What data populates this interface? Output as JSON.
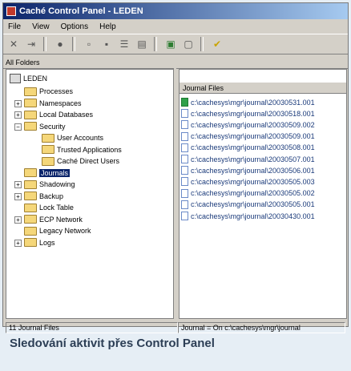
{
  "window": {
    "title": "Caché Control Panel - LEDEN"
  },
  "menu": [
    "File",
    "View",
    "Options",
    "Help"
  ],
  "panels": {
    "left_header": "All Folders",
    "right_header": ""
  },
  "tree": {
    "root": "LEDEN",
    "items": [
      {
        "label": "Processes",
        "expander": ""
      },
      {
        "label": "Namespaces",
        "expander": "+"
      },
      {
        "label": "Local Databases",
        "expander": "+"
      },
      {
        "label": "Security",
        "expander": "−"
      },
      {
        "label": "User Accounts",
        "expander": ""
      },
      {
        "label": "Trusted Applications",
        "expander": ""
      },
      {
        "label": "Caché Direct Users",
        "expander": ""
      },
      {
        "label": "Journals",
        "expander": ""
      },
      {
        "label": "Shadowing",
        "expander": "+"
      },
      {
        "label": "Backup",
        "expander": "+"
      },
      {
        "label": "Lock Table",
        "expander": ""
      },
      {
        "label": "ECP Network",
        "expander": "+"
      },
      {
        "label": "Legacy Network",
        "expander": ""
      },
      {
        "label": "Logs",
        "expander": "+"
      }
    ]
  },
  "list": {
    "column_header": "Journal Files",
    "rows": [
      "c:\\cachesys\\mgr\\journal\\20030531.001",
      "c:\\cachesys\\mgr\\journal\\20030518.001",
      "c:\\cachesys\\mgr\\journal\\20030509.002",
      "c:\\cachesys\\mgr\\journal\\20030509.001",
      "c:\\cachesys\\mgr\\journal\\20030508.001",
      "c:\\cachesys\\mgr\\journal\\20030507.001",
      "c:\\cachesys\\mgr\\journal\\20030506.001",
      "c:\\cachesys\\mgr\\journal\\20030505.003",
      "c:\\cachesys\\mgr\\journal\\20030505.002",
      "c:\\cachesys\\mgr\\journal\\20030505.001",
      "c:\\cachesys\\mgr\\journal\\20030430.001"
    ]
  },
  "status": {
    "left": "11 Journal Files",
    "right": "Journal = On c:\\cachesys\\mgr\\journal"
  },
  "caption": "Sledování aktivit přes Control Panel"
}
